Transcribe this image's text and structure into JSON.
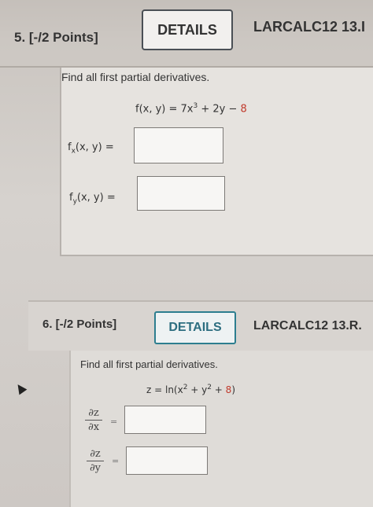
{
  "problem5": {
    "points": "5. [-/2 Points]",
    "details_label": "DETAILS",
    "reference": "LARCALC12 13.I",
    "instruction": "Find all first partial derivatives.",
    "function_lhs": "f(x, y) = 7x",
    "function_exp": "3",
    "function_mid": " + 2y − ",
    "function_const": "8",
    "fx_label_f": "f",
    "fx_label_sub": "x",
    "fx_label_rest": "(x, y)  =",
    "fy_label_f": "f",
    "fy_label_sub": "y",
    "fy_label_rest": "(x, y)  =",
    "fx_value": "",
    "fy_value": ""
  },
  "problem6": {
    "points": "6. [-/2 Points]",
    "details_label": "DETAILS",
    "reference": "LARCALC12 13.R.",
    "instruction": "Find all first partial derivatives.",
    "eq_start": "z = ln(x",
    "eq_exp1": "2",
    "eq_mid": " + y",
    "eq_exp2": "2",
    "eq_plus": " + ",
    "eq_const": "8",
    "eq_end": ")",
    "dzdx_num": "∂z",
    "dzdx_den": "∂x",
    "dzdy_num": "∂z",
    "dzdy_den": "∂y",
    "equals": "=",
    "dzdx_value": "",
    "dzdy_value": ""
  },
  "colors": {
    "accent_red": "#c0392b",
    "details_teal": "#2d7e8f"
  }
}
